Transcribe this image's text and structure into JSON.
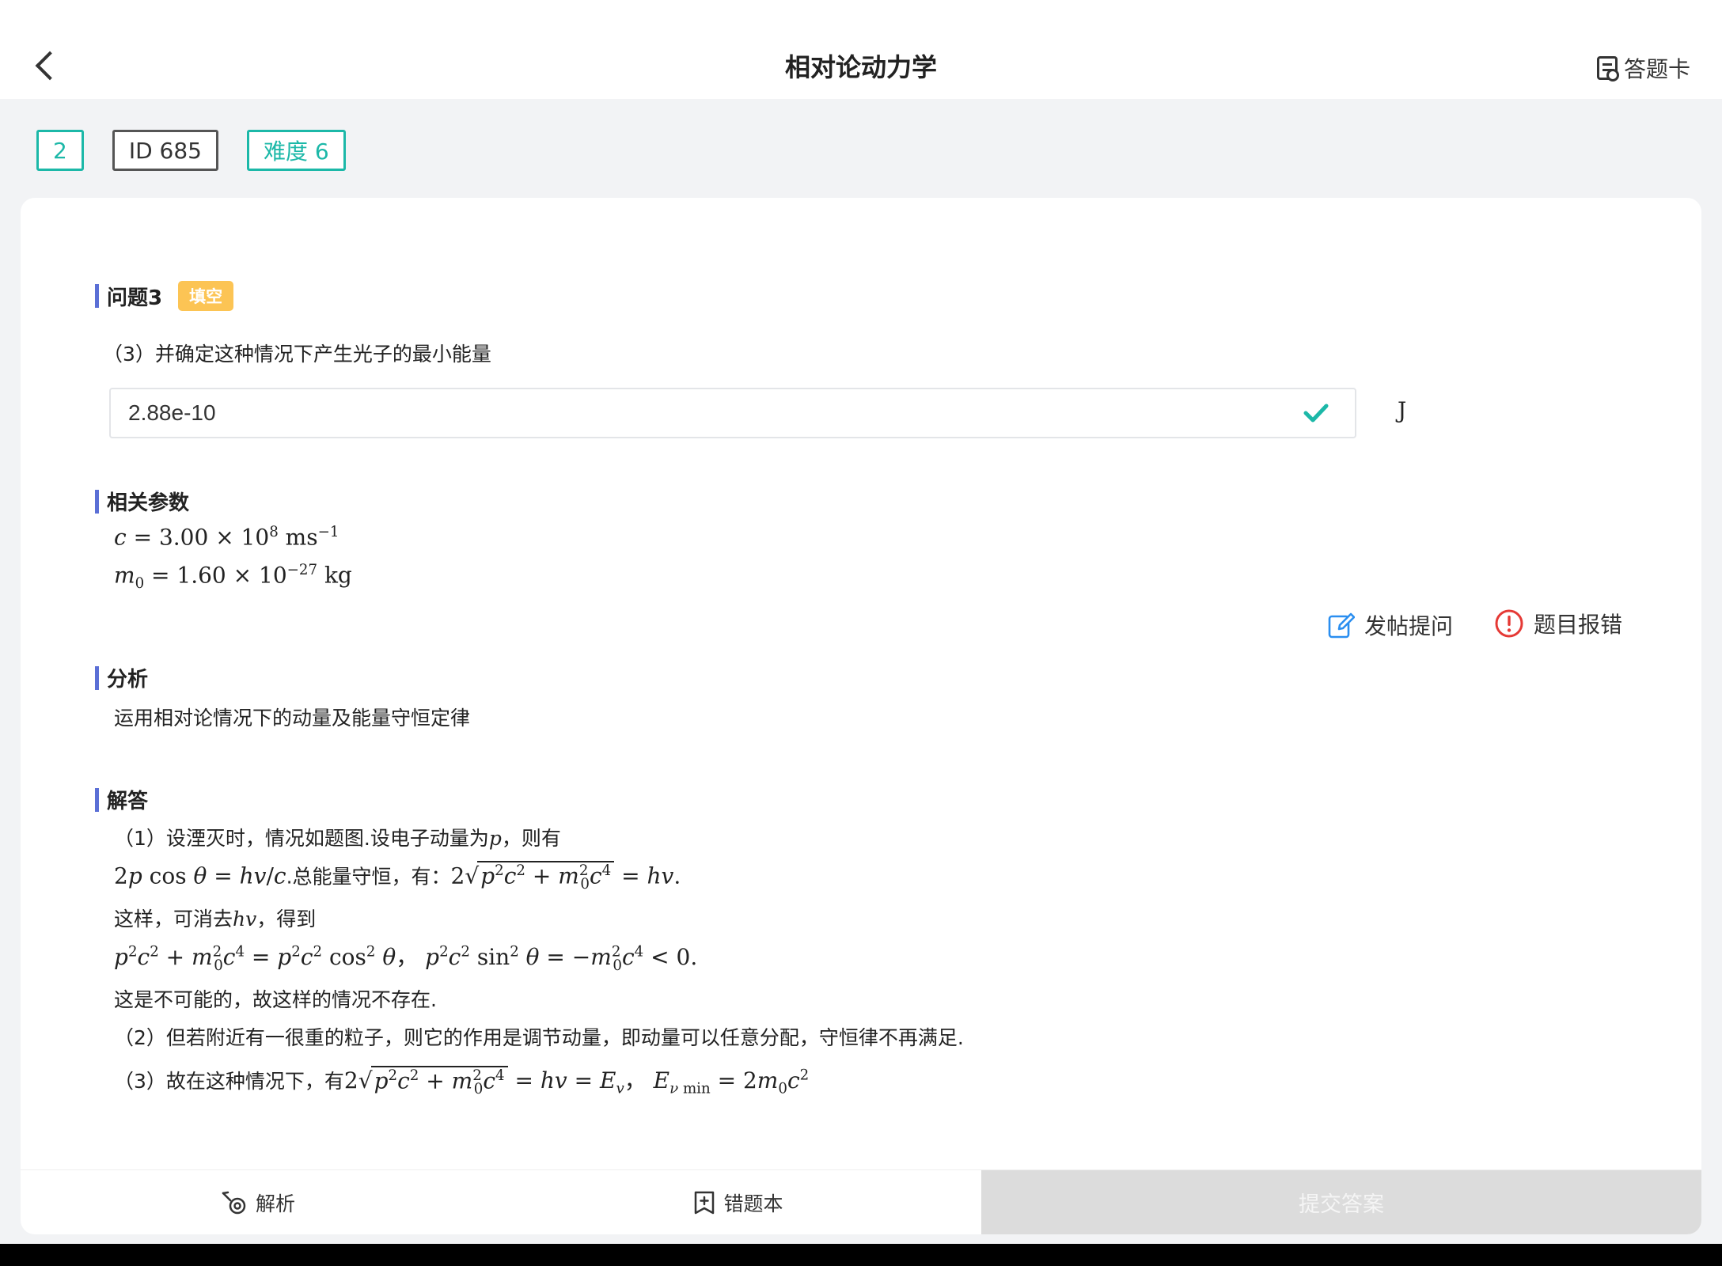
{
  "header": {
    "title": "相对论动力学",
    "answer_card_label": "答题卡"
  },
  "tags": {
    "number": "2",
    "id": "ID 685",
    "difficulty": "难度 6"
  },
  "question": {
    "title": "问题3",
    "badge": "填空",
    "text": "（3）并确定这种情况下产生光子的最小能量",
    "answer_value": "2.88e-10",
    "unit": "J"
  },
  "params": {
    "title": "相关参数",
    "c_value": "3.00",
    "c_exp": "8",
    "c_unit": "ms",
    "c_unit_exp": "−1",
    "m0_value": "1.60",
    "m0_exp": "−27",
    "m0_unit": "kg"
  },
  "actions": {
    "post_question": "发帖提问",
    "report_error": "题目报错"
  },
  "analysis": {
    "title": "分析",
    "text": "运用相对论情况下的动量及能量守恒定律"
  },
  "solution": {
    "title": "解答",
    "line1": "（1）设湮灭时，情况如题图.设电子动量为",
    "line1_end": "，则有",
    "line2_mid": ".总能量守恒，有：",
    "line3_a": "这样，可消去",
    "line3_b": "，得到",
    "line5": "这是不可能的，故这样的情况不存在.",
    "line6": "（2）但若附近有一很重的粒子，则它的作用是调节动量，即动量可以任意分配，守恒律不再满足.",
    "line7": "（3）故在这种情况下，有"
  },
  "bottom": {
    "analysis_label": "解析",
    "wrong_book_label": "错题本",
    "submit_label": "提交答案"
  }
}
